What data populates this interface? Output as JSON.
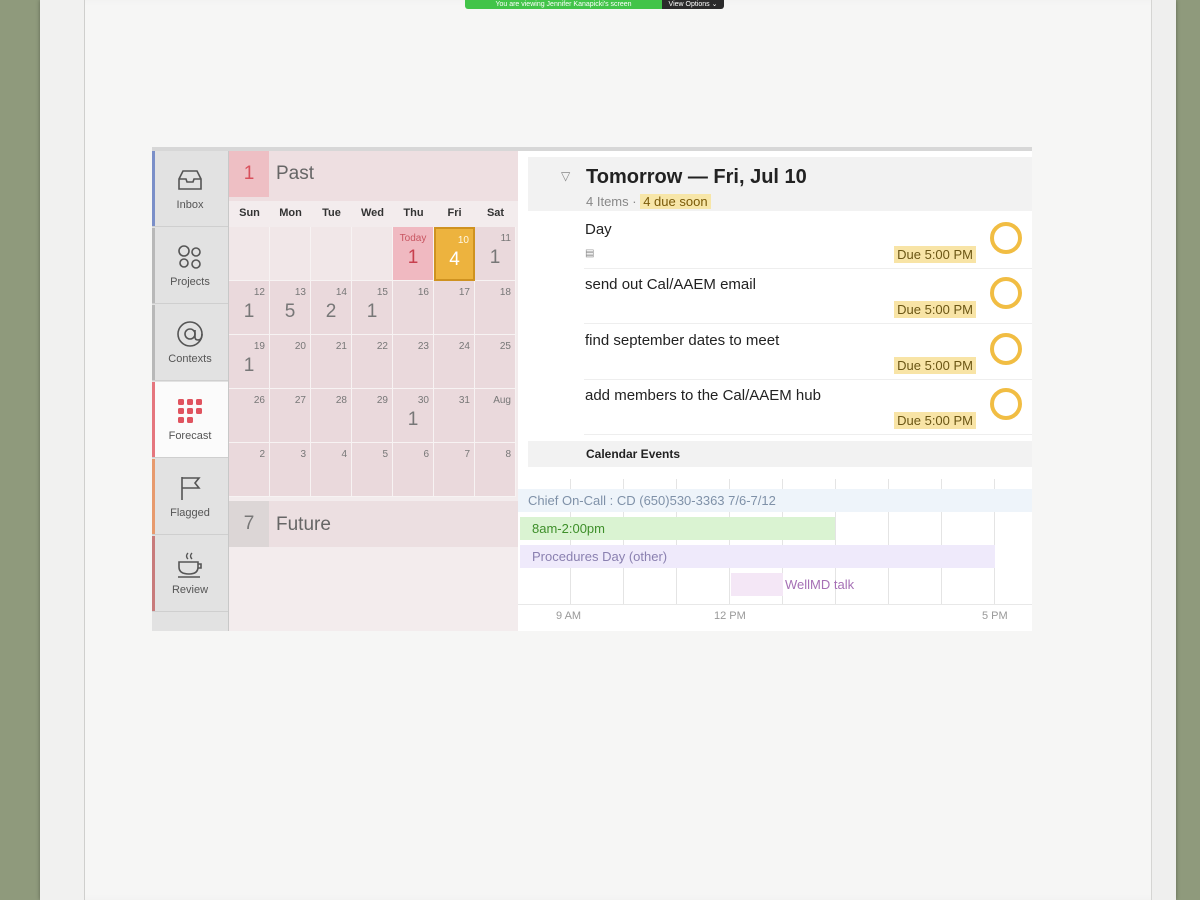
{
  "share_bar": {
    "message": "You are viewing Jennifer Kanapicki's screen",
    "options": "View Options ⌄"
  },
  "sidebar": {
    "items": [
      {
        "label": "Inbox",
        "icon": "inbox-icon"
      },
      {
        "label": "Projects",
        "icon": "projects-icon"
      },
      {
        "label": "Contexts",
        "icon": "at-sign-icon"
      },
      {
        "label": "Forecast",
        "icon": "forecast-grid-icon"
      },
      {
        "label": "Flagged",
        "icon": "flag-icon"
      },
      {
        "label": "Review",
        "icon": "coffee-cup-icon"
      }
    ],
    "active": "Forecast"
  },
  "calendar": {
    "past": {
      "count": "1",
      "label": "Past"
    },
    "weekdays": [
      "Sun",
      "Mon",
      "Tue",
      "Wed",
      "Thu",
      "Fri",
      "Sat"
    ],
    "weeks": [
      [
        {
          "d": "",
          "n": ""
        },
        {
          "d": "",
          "n": ""
        },
        {
          "d": "",
          "n": ""
        },
        {
          "d": "",
          "n": ""
        },
        {
          "d": "Today",
          "n": "1",
          "state": "today"
        },
        {
          "d": "10",
          "n": "4",
          "state": "selected"
        },
        {
          "d": "11",
          "n": "1"
        }
      ],
      [
        {
          "d": "12",
          "n": "1"
        },
        {
          "d": "13",
          "n": "5"
        },
        {
          "d": "14",
          "n": "2"
        },
        {
          "d": "15",
          "n": "1"
        },
        {
          "d": "16",
          "n": ""
        },
        {
          "d": "17",
          "n": ""
        },
        {
          "d": "18",
          "n": ""
        }
      ],
      [
        {
          "d": "19",
          "n": "1"
        },
        {
          "d": "20",
          "n": ""
        },
        {
          "d": "21",
          "n": ""
        },
        {
          "d": "22",
          "n": ""
        },
        {
          "d": "23",
          "n": ""
        },
        {
          "d": "24",
          "n": ""
        },
        {
          "d": "25",
          "n": ""
        }
      ],
      [
        {
          "d": "26",
          "n": ""
        },
        {
          "d": "27",
          "n": ""
        },
        {
          "d": "28",
          "n": ""
        },
        {
          "d": "29",
          "n": ""
        },
        {
          "d": "30",
          "n": "1"
        },
        {
          "d": "31",
          "n": ""
        },
        {
          "d": "Aug",
          "n": ""
        }
      ],
      [
        {
          "d": "2",
          "n": ""
        },
        {
          "d": "3",
          "n": ""
        },
        {
          "d": "4",
          "n": ""
        },
        {
          "d": "5",
          "n": ""
        },
        {
          "d": "6",
          "n": ""
        },
        {
          "d": "7",
          "n": ""
        },
        {
          "d": "8",
          "n": ""
        }
      ]
    ],
    "future": {
      "count": "7",
      "label": "Future"
    }
  },
  "day": {
    "title": "Tomorrow — Fri, Jul 10",
    "items_count": "4 Items",
    "separator": "·",
    "due_soon": "4 due soon"
  },
  "tasks": [
    {
      "name": "Day",
      "due": "Due 5:00 PM",
      "has_note": true
    },
    {
      "name": "send out Cal/AAEM email",
      "due": "Due 5:00 PM",
      "has_note": false
    },
    {
      "name": "find september dates to meet",
      "due": "Due 5:00 PM",
      "has_note": false
    },
    {
      "name": "add members to the Cal/AAEM hub",
      "due": "Due 5:00 PM",
      "has_note": false
    }
  ],
  "calendar_events": {
    "heading": "Calendar Events",
    "events": [
      "Chief On-Call : CD (650)530-3363 7/6-7/12",
      "8am-2:00pm",
      "Procedures Day (other)",
      "WellMD talk"
    ],
    "ticks": [
      "9 AM",
      "12 PM",
      "5 PM"
    ]
  },
  "colors": {
    "accent_today": "#d8505c",
    "accent_selected": "#edb33e",
    "due_ring": "#f1bd43"
  }
}
